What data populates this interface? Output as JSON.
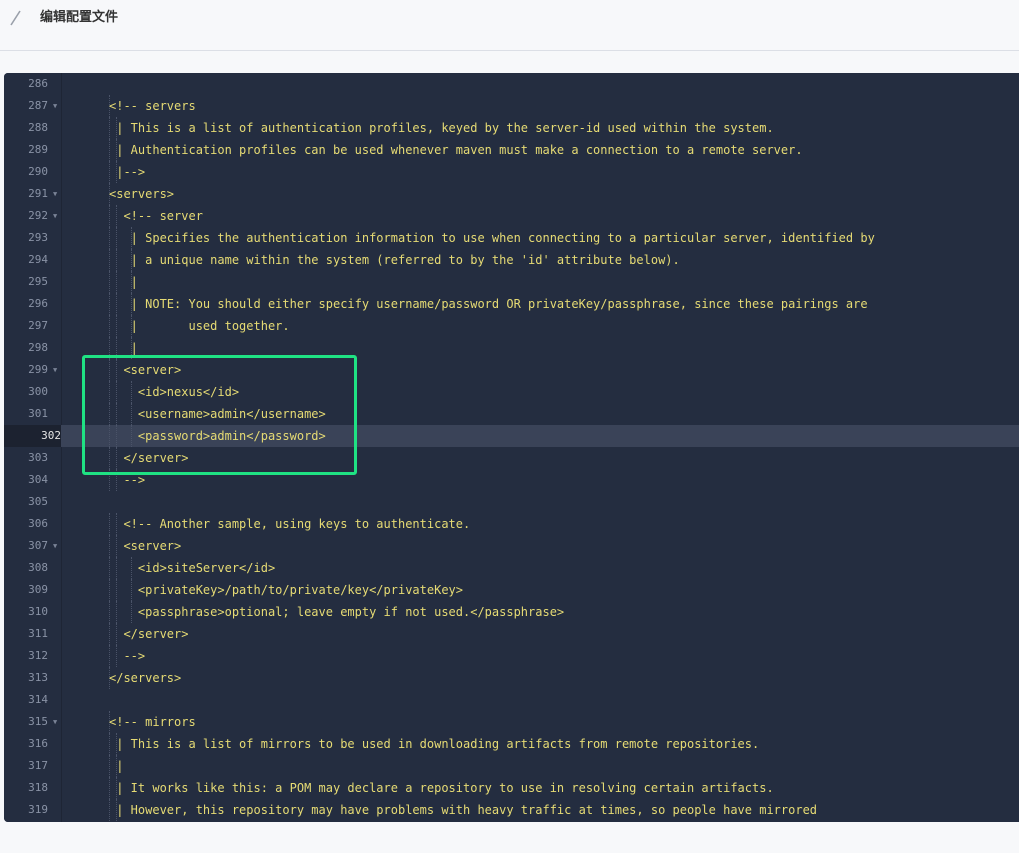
{
  "header": {
    "title": "编辑配置文件",
    "icon": "pencil-icon"
  },
  "editor": {
    "active_line": "302",
    "lines": [
      {
        "n": "286",
        "text": "",
        "fold": false,
        "indent": 0
      },
      {
        "n": "287",
        "text": "<!-- servers",
        "fold": true,
        "indent": 0
      },
      {
        "n": "288",
        "text": " | This is a list of authentication profiles, keyed by the server-id used within the system.",
        "fold": false,
        "indent": 0
      },
      {
        "n": "289",
        "text": " | Authentication profiles can be used whenever maven must make a connection to a remote server.",
        "fold": false,
        "indent": 0
      },
      {
        "n": "290",
        "text": " |-->",
        "fold": false,
        "indent": 0
      },
      {
        "n": "291",
        "text": "<servers>",
        "fold": true,
        "indent": 0
      },
      {
        "n": "292",
        "text": "  <!-- server",
        "fold": true,
        "indent": 0
      },
      {
        "n": "293",
        "text": "   | Specifies the authentication information to use when connecting to a particular server, identified by",
        "fold": false,
        "indent": 0
      },
      {
        "n": "294",
        "text": "   | a unique name within the system (referred to by the 'id' attribute below).",
        "fold": false,
        "indent": 0
      },
      {
        "n": "295",
        "text": "   |",
        "fold": false,
        "indent": 0
      },
      {
        "n": "296",
        "text": "   | NOTE: You should either specify username/password OR privateKey/passphrase, since these pairings are",
        "fold": false,
        "indent": 0
      },
      {
        "n": "297",
        "text": "   |       used together.",
        "fold": false,
        "indent": 0
      },
      {
        "n": "298",
        "text": "   |",
        "fold": false,
        "indent": 0
      },
      {
        "n": "299",
        "text": "  <server>",
        "fold": true,
        "indent": 0
      },
      {
        "n": "300",
        "text": "    <id>nexus</id>",
        "fold": false,
        "indent": 0
      },
      {
        "n": "301",
        "text": "    <username>admin</username>",
        "fold": false,
        "indent": 0
      },
      {
        "n": "302",
        "text": "    <password>admin</password>",
        "fold": false,
        "indent": 0
      },
      {
        "n": "303",
        "text": "  </server>",
        "fold": false,
        "indent": 0
      },
      {
        "n": "304",
        "text": "  -->",
        "fold": false,
        "indent": 0
      },
      {
        "n": "305",
        "text": "",
        "fold": false,
        "indent": 0
      },
      {
        "n": "306",
        "text": "  <!-- Another sample, using keys to authenticate.",
        "fold": false,
        "indent": 0
      },
      {
        "n": "307",
        "text": "  <server>",
        "fold": true,
        "indent": 0
      },
      {
        "n": "308",
        "text": "    <id>siteServer</id>",
        "fold": false,
        "indent": 0
      },
      {
        "n": "309",
        "text": "    <privateKey>/path/to/private/key</privateKey>",
        "fold": false,
        "indent": 0
      },
      {
        "n": "310",
        "text": "    <passphrase>optional; leave empty if not used.</passphrase>",
        "fold": false,
        "indent": 0
      },
      {
        "n": "311",
        "text": "  </server>",
        "fold": false,
        "indent": 0
      },
      {
        "n": "312",
        "text": "  -->",
        "fold": false,
        "indent": 0
      },
      {
        "n": "313",
        "text": "</servers>",
        "fold": false,
        "indent": 0
      },
      {
        "n": "314",
        "text": "",
        "fold": false,
        "indent": 0
      },
      {
        "n": "315",
        "text": "<!-- mirrors",
        "fold": true,
        "indent": 0
      },
      {
        "n": "316",
        "text": " | This is a list of mirrors to be used in downloading artifacts from remote repositories.",
        "fold": false,
        "indent": 0
      },
      {
        "n": "317",
        "text": " |",
        "fold": false,
        "indent": 0
      },
      {
        "n": "318",
        "text": " | It works like this: a POM may declare a repository to use in resolving certain artifacts.",
        "fold": false,
        "indent": 0
      },
      {
        "n": "319",
        "text": " | However, this repository may have problems with heavy traffic at times, so people have mirrored",
        "fold": false,
        "indent": 0
      }
    ]
  },
  "colors": {
    "editor_bg": "#242d40",
    "code_text": "#e6db74",
    "highlight_border": "#1fe283"
  }
}
